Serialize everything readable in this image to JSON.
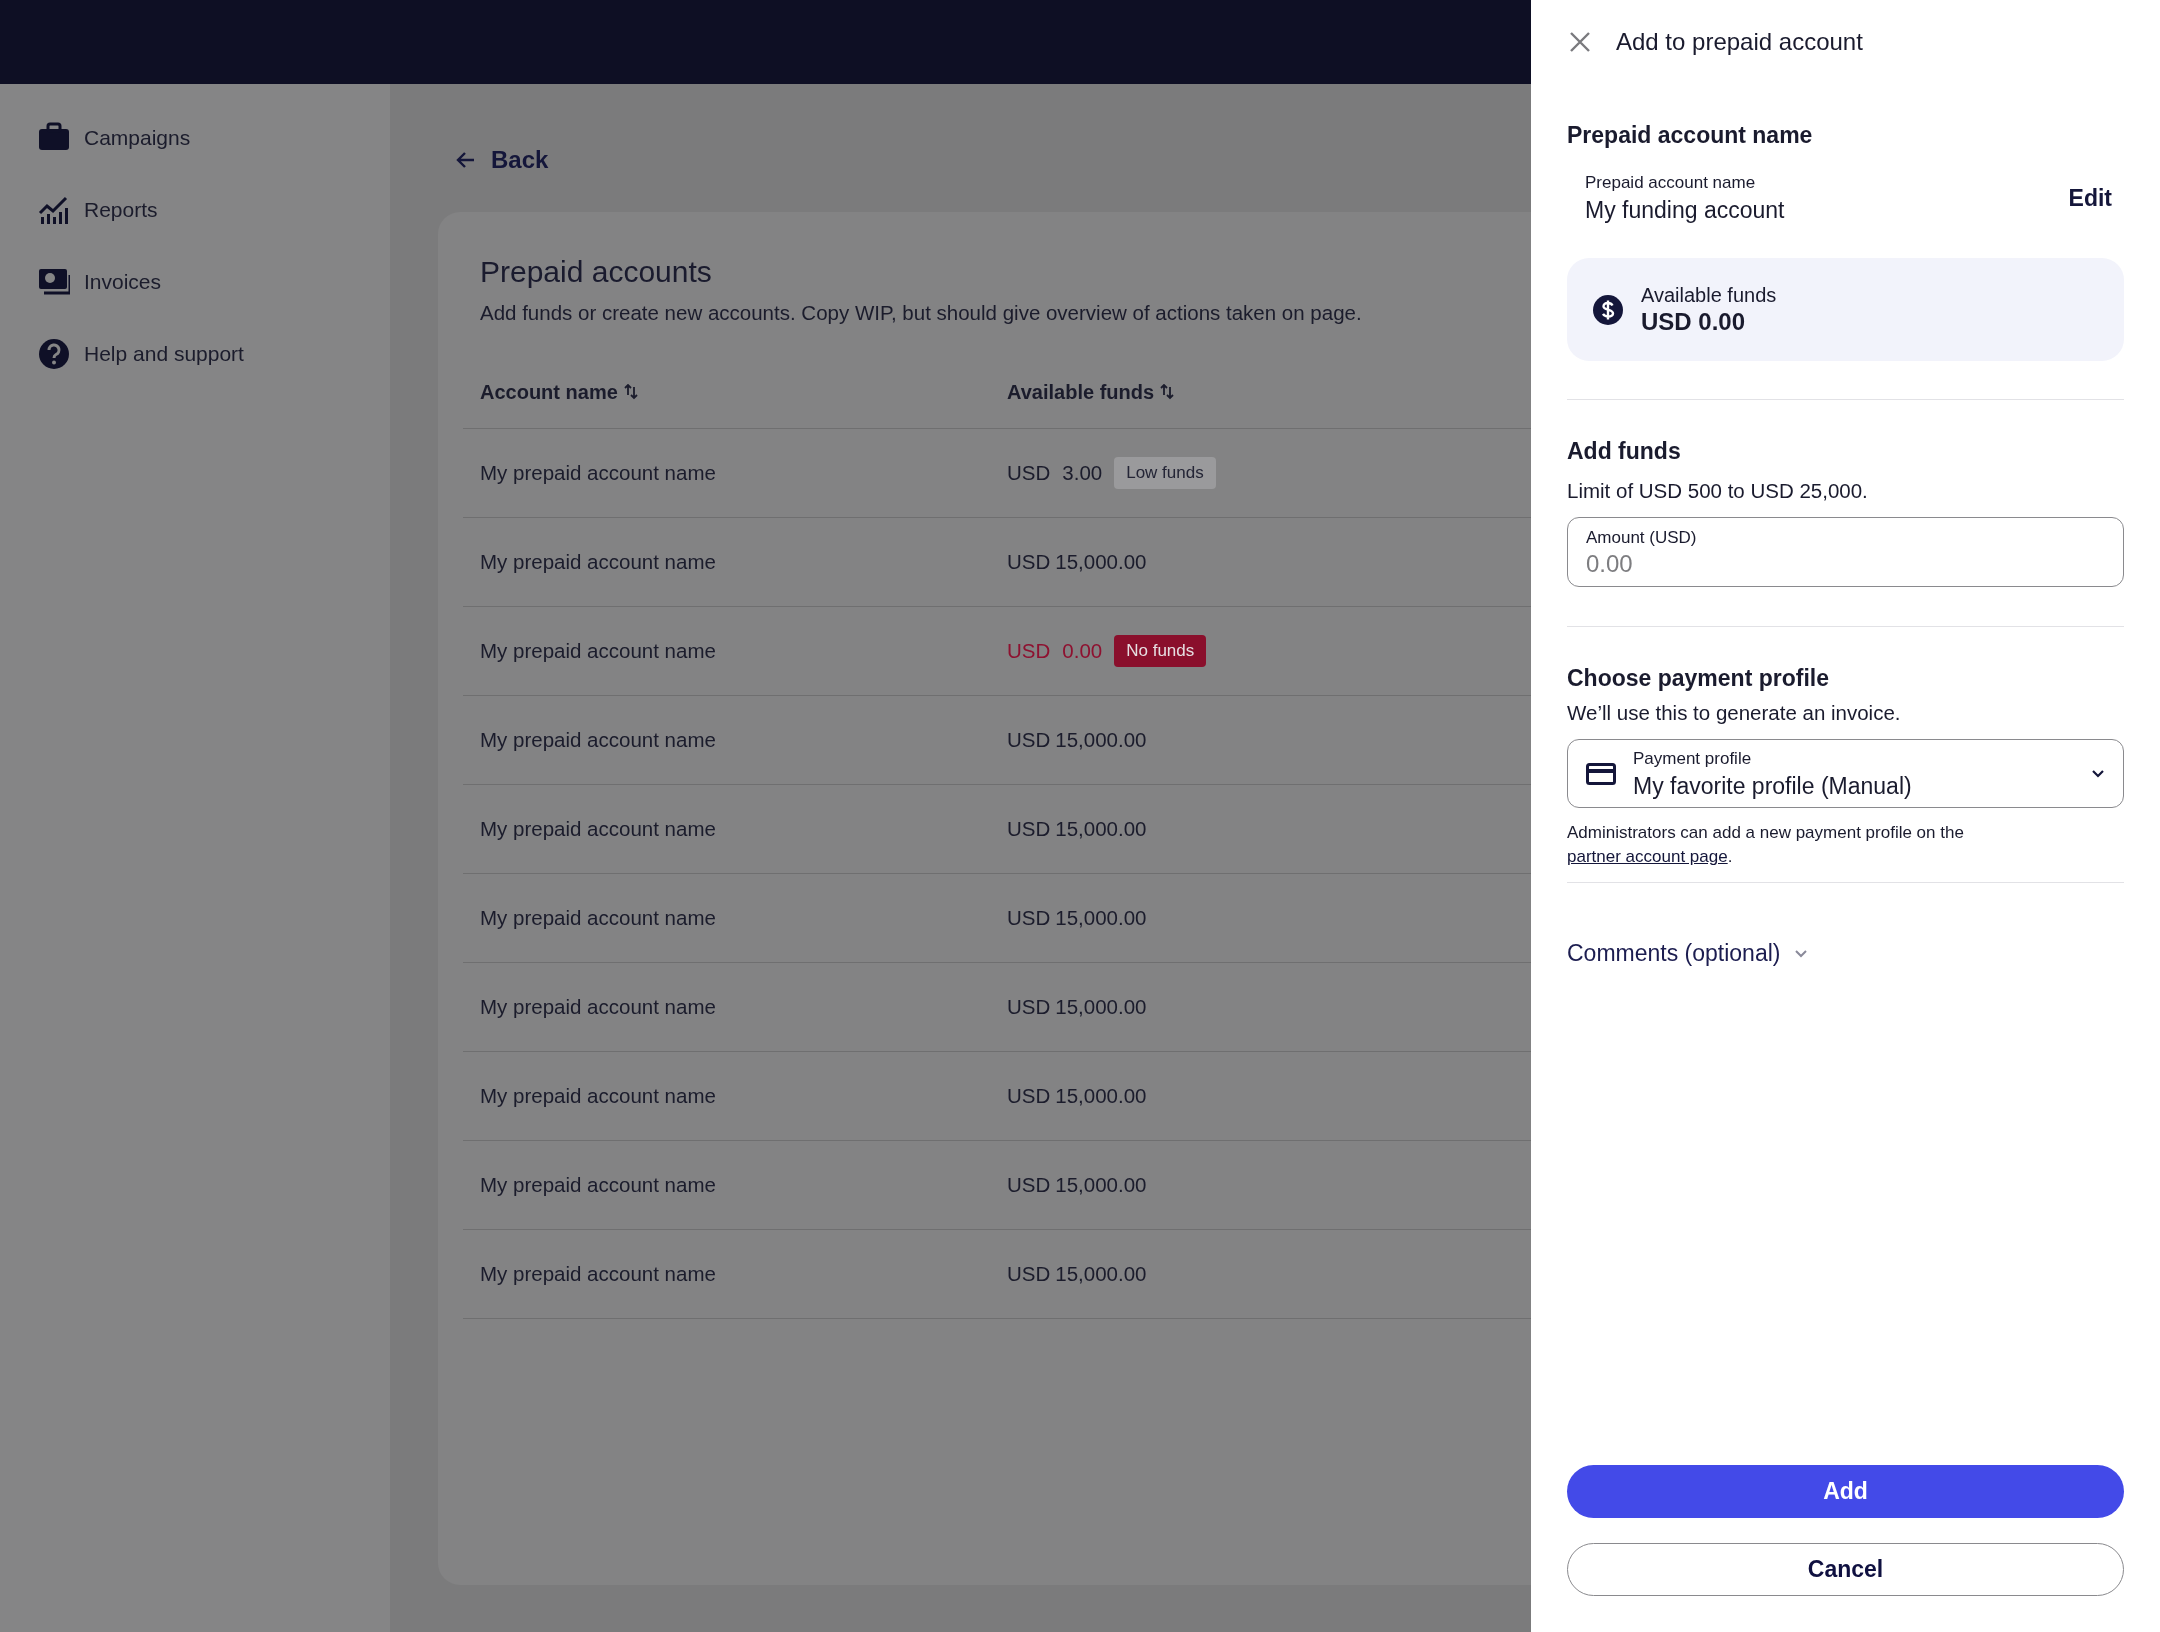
{
  "sidebar": {
    "items": [
      {
        "label": "Campaigns"
      },
      {
        "label": "Reports"
      },
      {
        "label": "Invoices"
      },
      {
        "label": "Help and support"
      }
    ]
  },
  "back_link": "Back",
  "page": {
    "title": "Prepaid accounts",
    "subtitle": "Add funds or create new accounts. Copy WIP, but should give overview of actions taken on page.",
    "columns": [
      "Account name",
      "Available funds"
    ],
    "rows": [
      {
        "name": "My prepaid account name",
        "currency": "USD",
        "amount": "3.00",
        "kind": "low",
        "badge": "Low funds"
      },
      {
        "name": "My prepaid account name",
        "currency": "USD",
        "amount": "15,000.00"
      },
      {
        "name": "My prepaid account name",
        "currency": "USD",
        "amount": "0.00",
        "kind": "empty",
        "badge": "No funds"
      },
      {
        "name": "My prepaid account name",
        "currency": "USD",
        "amount": "15,000.00"
      },
      {
        "name": "My prepaid account name",
        "currency": "USD",
        "amount": "15,000.00"
      },
      {
        "name": "My prepaid account name",
        "currency": "USD",
        "amount": "15,000.00"
      },
      {
        "name": "My prepaid account name",
        "currency": "USD",
        "amount": "15,000.00"
      },
      {
        "name": "My prepaid account name",
        "currency": "USD",
        "amount": "15,000.00"
      },
      {
        "name": "My prepaid account name",
        "currency": "USD",
        "amount": "15,000.00"
      },
      {
        "name": "My prepaid account name",
        "currency": "USD",
        "amount": "15,000.00"
      }
    ]
  },
  "drawer": {
    "title": "Add to prepaid account",
    "account": {
      "heading": "Prepaid account name",
      "field_label": "Prepaid account name",
      "field_value": "My funding account",
      "edit": "Edit"
    },
    "available": {
      "label": "Available funds",
      "value": "USD 0.00"
    },
    "add_funds": {
      "heading": "Add funds",
      "hint": "Limit of USD 500 to USD 25,000.",
      "amount_label": "Amount (USD)",
      "placeholder": "0.00"
    },
    "payment": {
      "heading": "Choose payment profile",
      "hint": "We’ll use this to generate an invoice.",
      "select_label": "Payment profile",
      "select_value": "My favorite profile (Manual)",
      "help_text": "Administrators can add a new payment profile on the",
      "help_link": "partner account page",
      "help_end": "."
    },
    "comments": {
      "label": "Comments (optional)",
      "expanded": false
    },
    "buttons": [
      {
        "label": "Add",
        "kind": "primary"
      },
      {
        "label": "Cancel",
        "kind": "secondary"
      }
    ]
  }
}
